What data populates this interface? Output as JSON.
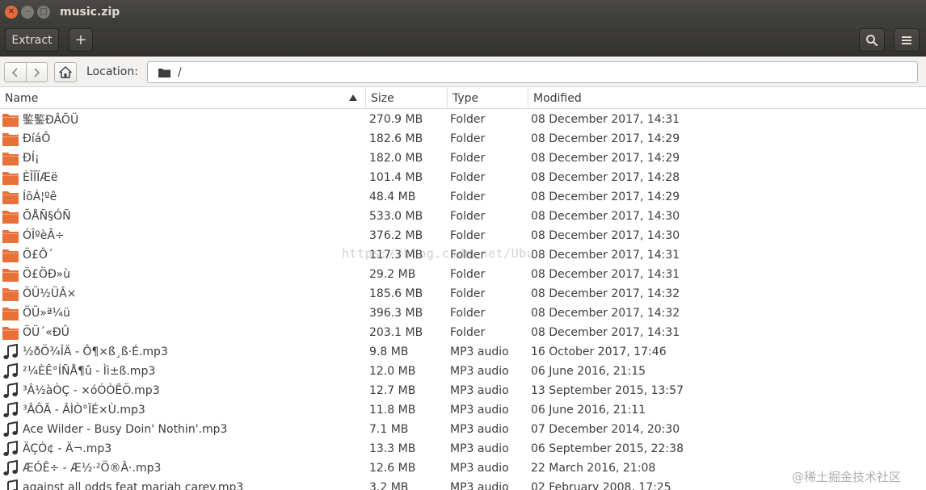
{
  "window": {
    "title": "music.zip"
  },
  "toolbar": {
    "extract_label": "Extract",
    "add_label": "+"
  },
  "location": {
    "label": "Location:",
    "path": "/"
  },
  "columns": {
    "name": "Name",
    "size": "Size",
    "type": "Type",
    "modified": "Modified"
  },
  "files": [
    {
      "icon": "folder-icon",
      "name": "鍳鍳ÐÂÕÜ",
      "size": "270.9 MB",
      "type": "Folder",
      "modified": "08 December 2017, 14:31"
    },
    {
      "icon": "folder-icon",
      "name": "ÐíáÔ",
      "size": "182.6 MB",
      "type": "Folder",
      "modified": "08 December 2017, 14:29"
    },
    {
      "icon": "folder-icon",
      "name": "ÐÍ¡",
      "size": "182.0 MB",
      "type": "Folder",
      "modified": "08 December 2017, 14:29"
    },
    {
      "icon": "folder-icon",
      "name": "ÈÎÎÏÆë",
      "size": "101.4 MB",
      "type": "Folder",
      "modified": "08 December 2017, 14:28"
    },
    {
      "icon": "folder-icon",
      "name": "ÍõÁ¦ºê",
      "size": "48.4 MB",
      "type": "Folder",
      "modified": "08 December 2017, 14:29"
    },
    {
      "icon": "folder-icon",
      "name": "ÕÅÑ§ÓÑ",
      "size": "533.0 MB",
      "type": "Folder",
      "modified": "08 December 2017, 14:30"
    },
    {
      "icon": "folder-icon",
      "name": "ÓÎºèÃ÷",
      "size": "376.2 MB",
      "type": "Folder",
      "modified": "08 December 2017, 14:30"
    },
    {
      "icon": "folder-icon",
      "name": "Ö£Ô´",
      "size": "117.3 MB",
      "type": "Folder",
      "modified": "08 December 2017, 14:31"
    },
    {
      "icon": "folder-icon",
      "name": "Ö£ÖÐ»ù",
      "size": "29.2 MB",
      "type": "Folder",
      "modified": "08 December 2017, 14:31"
    },
    {
      "icon": "folder-icon",
      "name": "ÖÜ½ÜÂ×",
      "size": "185.6 MB",
      "type": "Folder",
      "modified": "08 December 2017, 14:32"
    },
    {
      "icon": "folder-icon",
      "name": "ÖÜ»ª¼ü",
      "size": "396.3 MB",
      "type": "Folder",
      "modified": "08 December 2017, 14:32"
    },
    {
      "icon": "folder-icon",
      "name": "ÖÜ´«ÐÛ",
      "size": "203.1 MB",
      "type": "Folder",
      "modified": "08 December 2017, 14:31"
    },
    {
      "icon": "music-note-icon",
      "name": "½ðÖ¾ÎÄ - Ô¶×ß¸ß·É.mp3",
      "size": "9.8 MB",
      "type": "MP3 audio",
      "modified": "16 October 2017, 17:46"
    },
    {
      "icon": "music-note-icon",
      "name": "²¼ÈÊ°ÍÑÅ¶û - Ìì±ß.mp3",
      "size": "12.0 MB",
      "type": "MP3 audio",
      "modified": "06 June 2016, 21:15"
    },
    {
      "icon": "music-note-icon",
      "name": "³Â½àÒÇ - ×óÓÒÊÖ.mp3",
      "size": "12.7 MB",
      "type": "MP3 audio",
      "modified": "13 September 2015, 13:57"
    },
    {
      "icon": "music-note-icon",
      "name": "³ÂÔÃ - ÂÌÒ°ÏÉ×Ù.mp3",
      "size": "11.8 MB",
      "type": "MP3 audio",
      "modified": "06 June 2016, 21:11"
    },
    {
      "icon": "music-note-icon",
      "name": "Ace Wilder - Busy Doin' Nothin'.mp3",
      "size": "7.1 MB",
      "type": "MP3 audio",
      "modified": "07 December 2014, 20:30"
    },
    {
      "icon": "music-note-icon",
      "name": "ÄÇÓ¢ - Ä¬.mp3",
      "size": "13.3 MB",
      "type": "MP3 audio",
      "modified": "06 September 2015, 22:38"
    },
    {
      "icon": "music-note-icon",
      "name": "ÆÓÊ÷ - Æ½·²Ö®Â·.mp3",
      "size": "12.6 MB",
      "type": "MP3 audio",
      "modified": "22 March 2016, 21:08"
    },
    {
      "icon": "music-note-icon",
      "name": "against all odds feat mariah carey.mp3",
      "size": "3.2 MB",
      "type": "MP3 audio",
      "modified": "02 February 2008, 17:25"
    }
  ],
  "watermarks": {
    "center": "https://blog.csdn.net/Ubu",
    "corner": "@稀土掘金技术社区"
  },
  "colors": {
    "folder": "#e8703a",
    "titlebar": "#3c3b37",
    "close_button": "#e66a3c"
  }
}
